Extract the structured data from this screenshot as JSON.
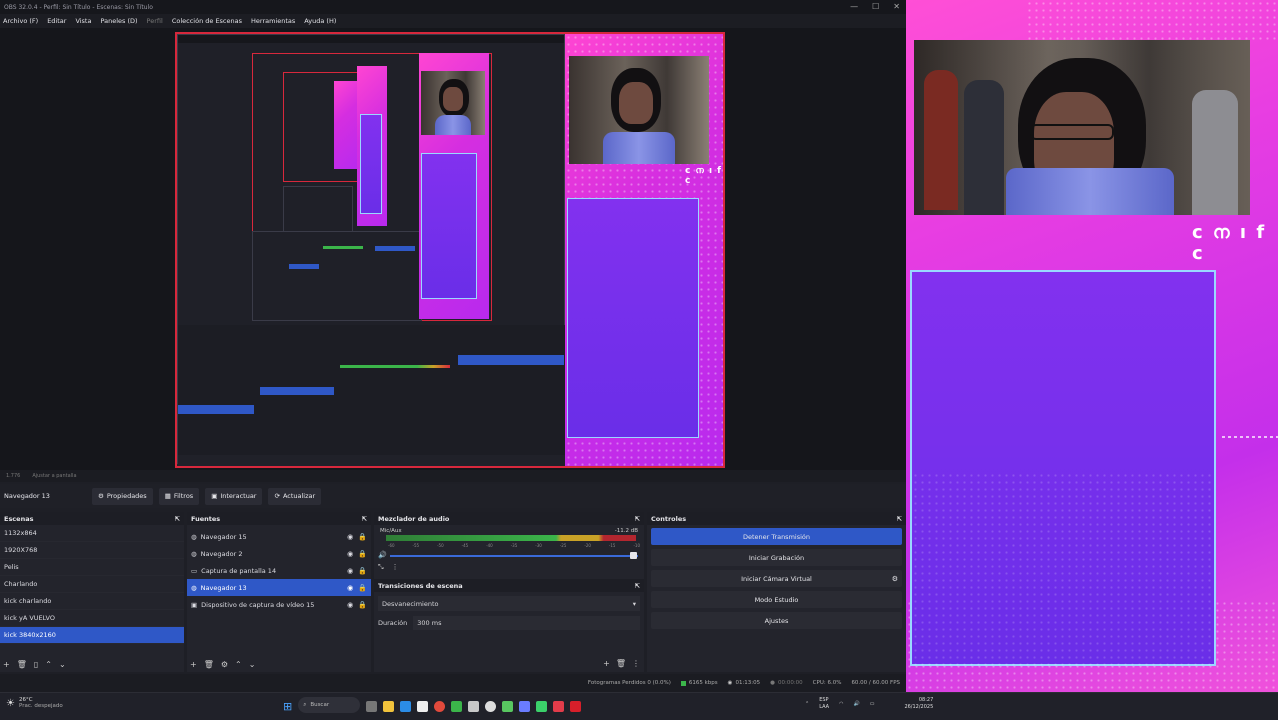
{
  "window": {
    "title": "OBS 32.0.4 - Perfil: Sin Título - Escenas: Sin Título",
    "controls": [
      "—",
      "☐",
      "✕"
    ]
  },
  "menu": {
    "items": [
      "Archivo (F)",
      "Editar",
      "Vista",
      "Paneles (D)",
      "Perfil",
      "Colección de Escenas",
      "Herramientas",
      "Ayuda (H)"
    ]
  },
  "canvas": {
    "overlay_text": "c ന ı f c"
  },
  "timeline": {
    "left": "1.776",
    "mid": "Ajustar a pantalla"
  },
  "source_toolbar": {
    "selected_source": "Navegador 13",
    "properties": "Propiedades",
    "filters": "Filtros",
    "interact": "Interactuar",
    "refresh": "Actualizar"
  },
  "scenes_dock": {
    "title": "Escenas",
    "items": [
      "1132x864",
      "1920X768",
      "Pelis",
      "Charlando",
      "kick charlando",
      "kick yA VUELVO",
      "kick 3840x2160"
    ],
    "selected_index": 6
  },
  "sources_dock": {
    "title": "Fuentes",
    "items": [
      {
        "label": "Navegador 15",
        "icon": "globe-icon"
      },
      {
        "label": "Navegador 2",
        "icon": "globe-icon"
      },
      {
        "label": "Captura de pantalla 14",
        "icon": "monitor-icon"
      },
      {
        "label": "Navegador 13",
        "icon": "globe-icon"
      },
      {
        "label": "Dispositivo de captura de vídeo 15",
        "icon": "camera-icon"
      }
    ],
    "selected_index": 3
  },
  "audio_dock": {
    "title": "Mezclador de audio",
    "channel": "Mic/Aux",
    "db": "-11.2 dB",
    "transitions_title": "Transiciones de escena",
    "transition": "Desvanecimiento",
    "duration_label": "Duración",
    "duration_value": "300 ms"
  },
  "controls_dock": {
    "title": "Controles",
    "buttons": [
      "Detener Transmisión",
      "Iniciar Grabación",
      "Iniciar Cámara Virtual",
      "Modo Estudio",
      "Ajustes"
    ]
  },
  "status": {
    "dropped": "Fotogramas Perdidos 0 (0.0%)",
    "bitrate": "6165 kbps",
    "live": "01:13:05",
    "rec": "00:00:00",
    "cpu": "CPU: 6.0%",
    "fps": "60.00 / 60.00 FPS"
  },
  "taskbar": {
    "weather_temp": "26°C",
    "weather_text": "Prac. despejado",
    "search": "Buscar",
    "lang": "ESP",
    "lang2": "LAA",
    "time": "08:27",
    "date": "26/12/2025"
  },
  "colors": {
    "accent": "#2f58c7",
    "live_border": "#d7283c",
    "pink": "#ff45d2",
    "purple": "#6a2ee8"
  }
}
